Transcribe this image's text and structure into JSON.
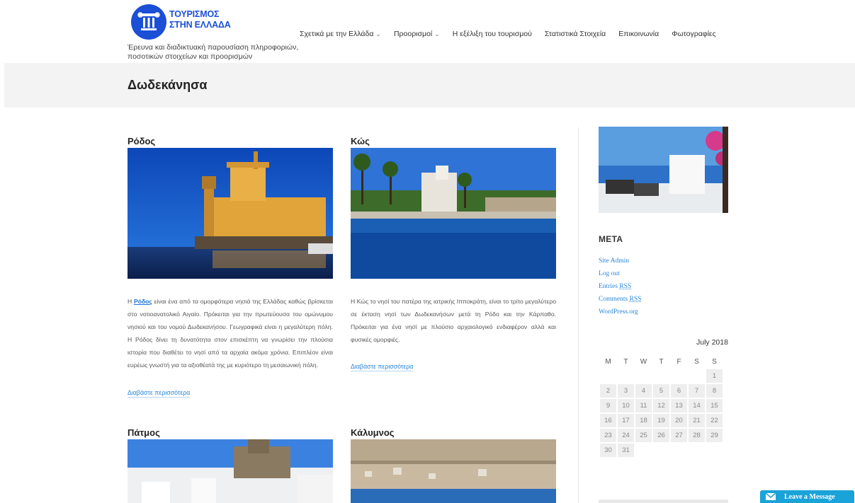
{
  "header": {
    "logo_line1": "ΤΟΥΡΙΣΜΟΣ",
    "logo_line2": "ΣΤΗΝ ΕΛΛΑΔΑ",
    "tagline": "Έρευνα και διαδικτυακή παρουσίαση πληροφοριών, ποσοτικών στοιχείων και προορισμών",
    "nav": [
      {
        "label": "Σχετικά με την Ελλάδα",
        "has_dropdown": true
      },
      {
        "label": "Προορισμοί",
        "has_dropdown": true
      },
      {
        "label": "Η εξέλιξη του τουρισμού",
        "has_dropdown": false
      },
      {
        "label": "Στατιστικά Στοιχεία",
        "has_dropdown": false
      },
      {
        "label": "Επικοινωνία",
        "has_dropdown": false
      },
      {
        "label": "Φωτογραφίες",
        "has_dropdown": false
      }
    ]
  },
  "page_title": "Δωδεκάνησα",
  "posts": [
    {
      "title": "Ρόδος",
      "link_word": "Ρόδος",
      "text_before": "Η ",
      "text_after": " είναι ένα από τα ομορφότερα νησιά της Ελλάδας καθώς βρίσκεται στο νοτιοανατολικό Αιγαίο. Πρόκειται για την πρωτεύουσα του ομώνυμου νησιού και του νομού Δωδεκανήσου. Γεωγραφικά είναι η μεγαλύτερη πόλη. Η Ρόδος δίνει τη δυνατότητα στον επισκέπτη να γνωρίσει την πλούσια ιστορία που διαθέτει το νησί από τα αρχαία ακόμα χρόνια. Επιπλέον είναι ευρέως γνωστή για τα αξιοθέατά της με κυριότερο τη μεσαιωνική πόλη.",
      "read_more": "Διαβάστε περισσότερα"
    },
    {
      "title": "Κώς",
      "text": "Η Κώς το νησί του πατέρα της ιατρικής Ιπποκράτη, είναι το τρίτο μεγαλύτερο σε έκταση νησί των Δωδεκανήσων μετά τη Ρόδο και την Κάρπαθο. Πρόκειται για ένα νησί με πλούσιο αρχαιολογικό ενδιαφέρον αλλά και φυσικές ομορφιές.",
      "read_more": "Διαβάστε περισσότερα"
    },
    {
      "title": "Πάτμος"
    },
    {
      "title": "Κάλυμνος"
    }
  ],
  "sidebar": {
    "meta_title": "META",
    "meta_links": [
      {
        "label": "Site Admin",
        "rss": ""
      },
      {
        "label": "Log out",
        "rss": ""
      },
      {
        "label": "Entries ",
        "rss": "RSS"
      },
      {
        "label": "Comments ",
        "rss": "RSS"
      },
      {
        "label": "WordPress.org",
        "rss": ""
      }
    ],
    "calendar": {
      "caption": "July 2018",
      "weekdays": [
        "M",
        "T",
        "W",
        "T",
        "F",
        "S",
        "S"
      ],
      "weeks": [
        [
          "",
          "",
          "",
          "",
          "",
          "",
          "1"
        ],
        [
          "2",
          "3",
          "4",
          "5",
          "6",
          "7",
          "8"
        ],
        [
          "9",
          "10",
          "11",
          "12",
          "13",
          "14",
          "15"
        ],
        [
          "16",
          "17",
          "18",
          "19",
          "20",
          "21",
          "22"
        ],
        [
          "23",
          "24",
          "25",
          "26",
          "27",
          "28",
          "29"
        ],
        [
          "30",
          "31",
          "",
          "",
          "",
          "",
          ""
        ]
      ]
    }
  },
  "chat": {
    "label": "Leave a Message"
  },
  "colors": {
    "brand": "#1a4fd6",
    "link": "#2a86d8",
    "chat": "#1aa3d8"
  }
}
